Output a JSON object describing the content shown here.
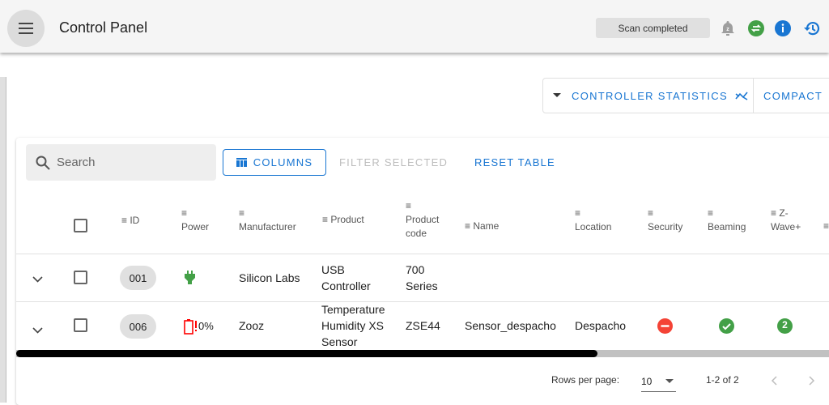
{
  "header": {
    "title": "Control Panel",
    "status": "Scan completed"
  },
  "toolbar": {
    "controller_statistics": "CONTROLLER STATISTICS",
    "compact": "COMPACT"
  },
  "table_toolbar": {
    "search_placeholder": "Search",
    "columns": "COLUMNS",
    "filter_selected": "FILTER SELECTED",
    "reset_table": "RESET TABLE"
  },
  "columns": [
    "ID",
    "Power",
    "Manufacturer",
    "Product",
    "Product code",
    "Name",
    "Location",
    "Security",
    "Beaming",
    "Z-Wave+"
  ],
  "rows": [
    {
      "id": "001",
      "power": "plug",
      "battery": "",
      "manufacturer": "Silicon Labs",
      "product": "USB Controller",
      "product_code": "700 Series",
      "name": "",
      "location": "",
      "security": "",
      "beaming": "",
      "zwave_plus": ""
    },
    {
      "id": "006",
      "power": "battery",
      "battery": "0%",
      "manufacturer": "Zooz",
      "product": "Temperature Humidity XS Sensor",
      "product_code": "ZSE44",
      "name": "Sensor_despacho",
      "location": "Despacho",
      "security": "none",
      "beaming": "yes",
      "zwave_plus": "2"
    }
  ],
  "pagination": {
    "rows_per_page_label": "Rows per page:",
    "rows_per_page": "10",
    "range": "1-2 of 2"
  },
  "colors": {
    "accent": "#1976d2",
    "green": "#43a047",
    "red": "#f44336"
  }
}
